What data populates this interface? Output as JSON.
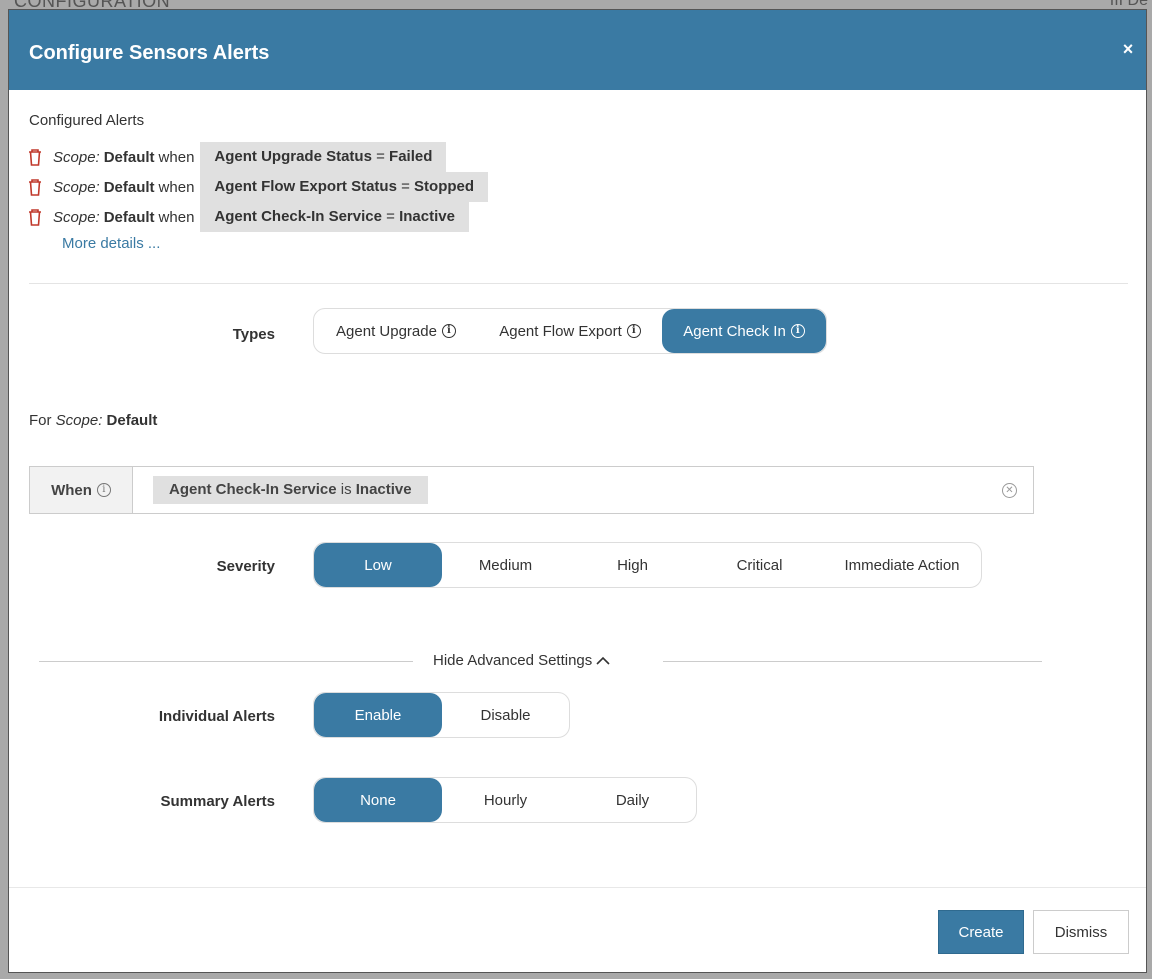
{
  "backdrop": {
    "title": "CONFIGURATION",
    "right_text": "III De"
  },
  "modal": {
    "title": "Configure Sensors Alerts",
    "close_label": "×"
  },
  "configured": {
    "label": "Configured Alerts",
    "rows": [
      {
        "scope_label": "Scope:",
        "scope": "Default",
        "when": "when",
        "field": "Agent Upgrade Status",
        "op": "=",
        "value": "Failed"
      },
      {
        "scope_label": "Scope:",
        "scope": "Default",
        "when": "when",
        "field": "Agent Flow Export Status",
        "op": "=",
        "value": "Stopped"
      },
      {
        "scope_label": "Scope:",
        "scope": "Default",
        "when": "when",
        "field": "Agent Check-In Service",
        "op": "=",
        "value": "Inactive"
      }
    ],
    "more_link": "More details ..."
  },
  "types": {
    "label": "Types",
    "options": [
      "Agent Upgrade",
      "Agent Flow Export",
      "Agent Check In"
    ],
    "selected": "Agent Check In"
  },
  "for_scope": {
    "prefix": "For",
    "scope_label": "Scope:",
    "scope": "Default"
  },
  "when": {
    "label": "When",
    "field": "Agent Check-In Service",
    "op": "is",
    "value": "Inactive"
  },
  "severity": {
    "label": "Severity",
    "options": [
      "Low",
      "Medium",
      "High",
      "Critical",
      "Immediate Action"
    ],
    "selected": "Low"
  },
  "advanced": {
    "toggle_label": "Hide Advanced Settings"
  },
  "individual": {
    "label": "Individual Alerts",
    "options": [
      "Enable",
      "Disable"
    ],
    "selected": "Enable"
  },
  "summary": {
    "label": "Summary Alerts",
    "options": [
      "None",
      "Hourly",
      "Daily"
    ],
    "selected": "None"
  },
  "footer": {
    "create_label": "Create",
    "dismiss_label": "Dismiss"
  },
  "colors": {
    "accent": "#3a7aa3",
    "chip": "#e0e0e0",
    "trash": "#c0392b"
  }
}
